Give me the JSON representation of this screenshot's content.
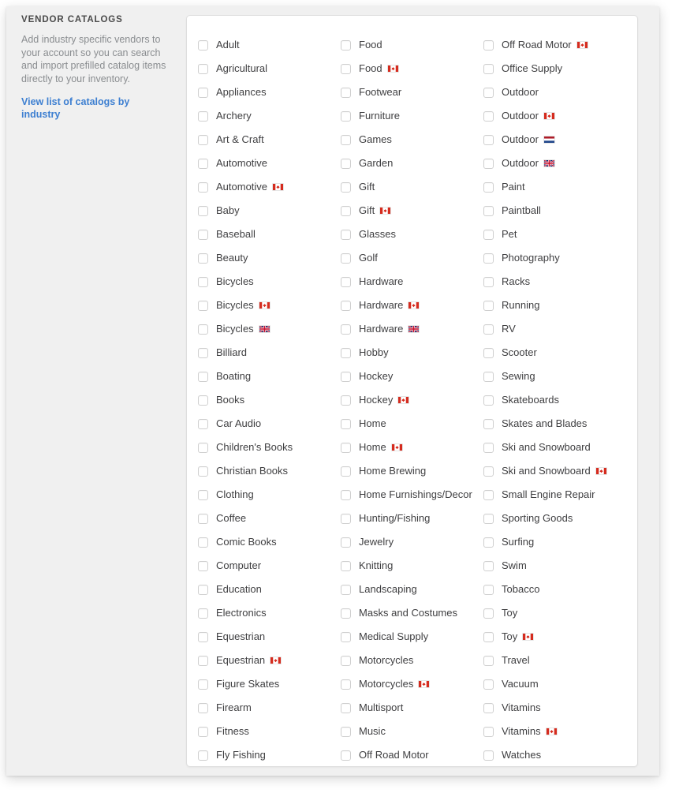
{
  "intro": {
    "title": "VENDOR CATALOGS",
    "body": "Add industry specific vendors to your account so you can search and import prefilled catalog items directly to your inventory.",
    "link": "View list of catalogs by industry"
  },
  "colors": {
    "link": "#3d7fd1",
    "panel_bg": "#f0f0f0",
    "card_bg": "#ffffff",
    "card_border": "#dedede",
    "label_text": "#3f3f41",
    "intro_body_text": "#8a8d90",
    "checkbox_border": "#cfcfcf",
    "flag_ca_red": "#d52b1e",
    "flag_nl_red": "#ae1c28",
    "flag_nl_blue": "#21468b",
    "flag_uk_blue": "#012169",
    "flag_uk_red": "#c8102e"
  },
  "checkbox_state": "unchecked",
  "columns": [
    [
      {
        "label": "Adult",
        "flag": null
      },
      {
        "label": "Agricultural",
        "flag": null
      },
      {
        "label": "Appliances",
        "flag": null
      },
      {
        "label": "Archery",
        "flag": null
      },
      {
        "label": "Art & Craft",
        "flag": null
      },
      {
        "label": "Automotive",
        "flag": null
      },
      {
        "label": "Automotive",
        "flag": "ca"
      },
      {
        "label": "Baby",
        "flag": null
      },
      {
        "label": "Baseball",
        "flag": null
      },
      {
        "label": "Beauty",
        "flag": null
      },
      {
        "label": "Bicycles",
        "flag": null
      },
      {
        "label": "Bicycles",
        "flag": "ca"
      },
      {
        "label": "Bicycles",
        "flag": "uk"
      },
      {
        "label": "Billiard",
        "flag": null
      },
      {
        "label": "Boating",
        "flag": null
      },
      {
        "label": "Books",
        "flag": null
      },
      {
        "label": "Car Audio",
        "flag": null
      },
      {
        "label": "Children's Books",
        "flag": null
      },
      {
        "label": "Christian Books",
        "flag": null
      },
      {
        "label": "Clothing",
        "flag": null
      },
      {
        "label": "Coffee",
        "flag": null
      },
      {
        "label": "Comic Books",
        "flag": null
      },
      {
        "label": "Computer",
        "flag": null
      },
      {
        "label": "Education",
        "flag": null
      },
      {
        "label": "Electronics",
        "flag": null
      },
      {
        "label": "Equestrian",
        "flag": null
      },
      {
        "label": "Equestrian",
        "flag": "ca"
      },
      {
        "label": "Figure Skates",
        "flag": null
      },
      {
        "label": "Firearm",
        "flag": null
      },
      {
        "label": "Fitness",
        "flag": null
      },
      {
        "label": "Fly Fishing",
        "flag": null
      }
    ],
    [
      {
        "label": "Food",
        "flag": null
      },
      {
        "label": "Food",
        "flag": "ca"
      },
      {
        "label": "Footwear",
        "flag": null
      },
      {
        "label": "Furniture",
        "flag": null
      },
      {
        "label": "Games",
        "flag": null
      },
      {
        "label": "Garden",
        "flag": null
      },
      {
        "label": "Gift",
        "flag": null
      },
      {
        "label": "Gift",
        "flag": "ca"
      },
      {
        "label": "Glasses",
        "flag": null
      },
      {
        "label": "Golf",
        "flag": null
      },
      {
        "label": "Hardware",
        "flag": null
      },
      {
        "label": "Hardware",
        "flag": "ca"
      },
      {
        "label": "Hardware",
        "flag": "uk"
      },
      {
        "label": "Hobby",
        "flag": null
      },
      {
        "label": "Hockey",
        "flag": null
      },
      {
        "label": "Hockey",
        "flag": "ca"
      },
      {
        "label": "Home",
        "flag": null
      },
      {
        "label": "Home",
        "flag": "ca"
      },
      {
        "label": "Home Brewing",
        "flag": null
      },
      {
        "label": "Home Furnishings/Decor",
        "flag": null
      },
      {
        "label": "Hunting/Fishing",
        "flag": null
      },
      {
        "label": "Jewelry",
        "flag": null
      },
      {
        "label": "Knitting",
        "flag": null
      },
      {
        "label": "Landscaping",
        "flag": null
      },
      {
        "label": "Masks and Costumes",
        "flag": null
      },
      {
        "label": "Medical Supply",
        "flag": null
      },
      {
        "label": "Motorcycles",
        "flag": null
      },
      {
        "label": "Motorcycles",
        "flag": "ca"
      },
      {
        "label": "Multisport",
        "flag": null
      },
      {
        "label": "Music",
        "flag": null
      },
      {
        "label": "Off Road Motor",
        "flag": null
      }
    ],
    [
      {
        "label": "Off Road Motor",
        "flag": "ca"
      },
      {
        "label": "Office Supply",
        "flag": null
      },
      {
        "label": "Outdoor",
        "flag": null
      },
      {
        "label": "Outdoor",
        "flag": "ca"
      },
      {
        "label": "Outdoor",
        "flag": "nl"
      },
      {
        "label": "Outdoor",
        "flag": "uk"
      },
      {
        "label": "Paint",
        "flag": null
      },
      {
        "label": "Paintball",
        "flag": null
      },
      {
        "label": "Pet",
        "flag": null
      },
      {
        "label": "Photography",
        "flag": null
      },
      {
        "label": "Racks",
        "flag": null
      },
      {
        "label": "Running",
        "flag": null
      },
      {
        "label": "RV",
        "flag": null
      },
      {
        "label": "Scooter",
        "flag": null
      },
      {
        "label": "Sewing",
        "flag": null
      },
      {
        "label": "Skateboards",
        "flag": null
      },
      {
        "label": "Skates and Blades",
        "flag": null
      },
      {
        "label": "Ski and Snowboard",
        "flag": null
      },
      {
        "label": "Ski and Snowboard",
        "flag": "ca"
      },
      {
        "label": "Small Engine Repair",
        "flag": null
      },
      {
        "label": "Sporting Goods",
        "flag": null
      },
      {
        "label": "Surfing",
        "flag": null
      },
      {
        "label": "Swim",
        "flag": null
      },
      {
        "label": "Tobacco",
        "flag": null
      },
      {
        "label": "Toy",
        "flag": null
      },
      {
        "label": "Toy",
        "flag": "ca"
      },
      {
        "label": "Travel",
        "flag": null
      },
      {
        "label": "Vacuum",
        "flag": null
      },
      {
        "label": "Vitamins",
        "flag": null
      },
      {
        "label": "Vitamins",
        "flag": "ca"
      },
      {
        "label": "Watches",
        "flag": null
      }
    ]
  ]
}
